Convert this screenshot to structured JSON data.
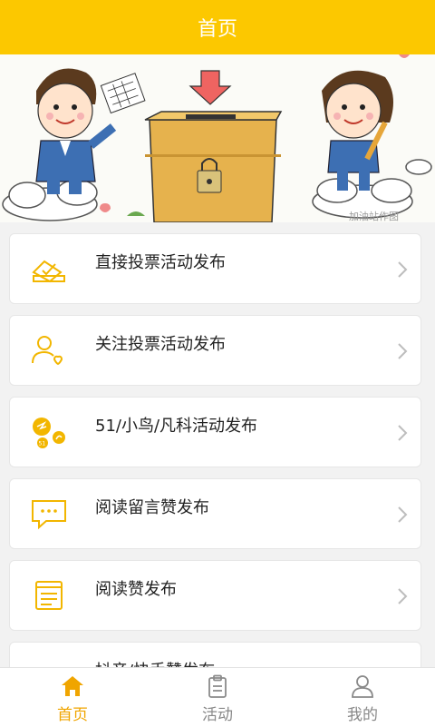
{
  "header": {
    "title": "首页"
  },
  "banner": {
    "watermark": "加油站作图"
  },
  "list": {
    "items": [
      {
        "label": "直接投票活动发布",
        "icon": "ballot-box-icon"
      },
      {
        "label": "关注投票活动发布",
        "icon": "user-heart-icon"
      },
      {
        "label": "51/小鸟/凡科活动发布",
        "icon": "platform-badges-icon"
      },
      {
        "label": "阅读留言赞发布",
        "icon": "comment-bubble-icon"
      },
      {
        "label": "阅读赞发布",
        "icon": "document-icon"
      },
      {
        "label": "抖音/快手赞发布",
        "icon": "video-icon"
      }
    ]
  },
  "tabbar": {
    "tabs": [
      {
        "label": "首页",
        "icon": "home-icon",
        "active": true
      },
      {
        "label": "活动",
        "icon": "clipboard-icon",
        "active": false
      },
      {
        "label": "我的",
        "icon": "user-icon",
        "active": false
      }
    ]
  },
  "colors": {
    "accent": "#fcc800",
    "icon_yellow": "#f2b600",
    "active_tab": "#f0a500"
  }
}
